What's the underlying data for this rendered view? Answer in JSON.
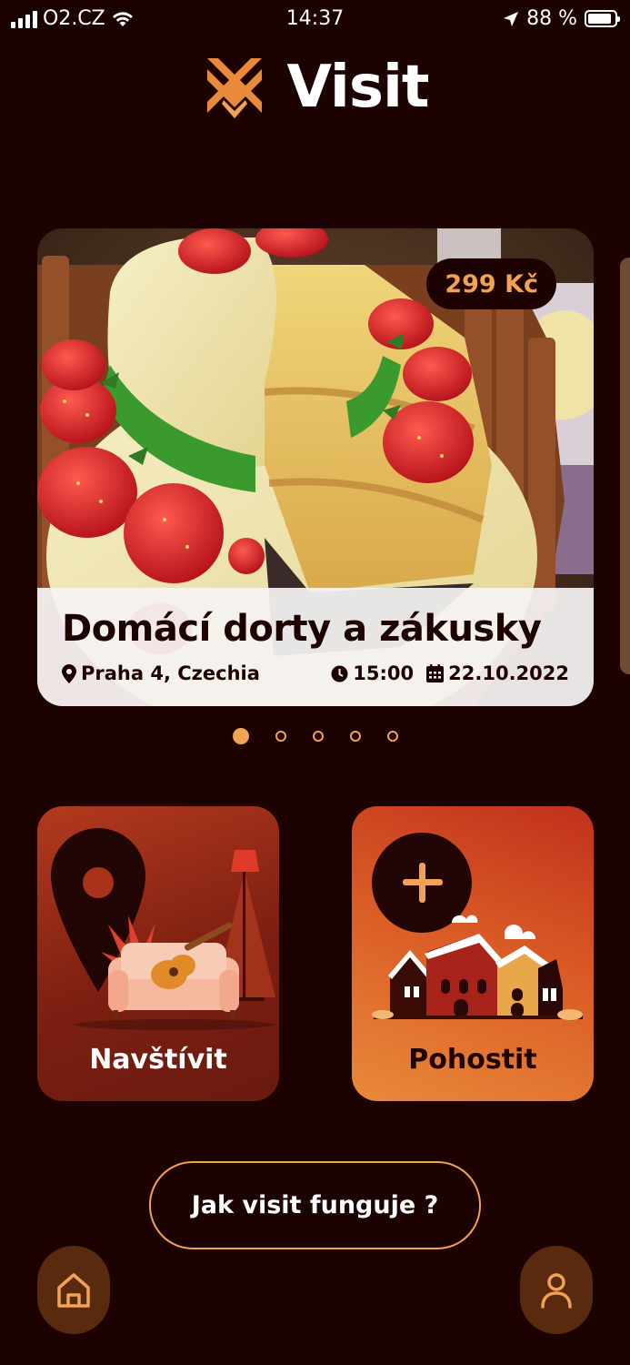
{
  "status_bar": {
    "carrier": "O2.CZ",
    "time": "14:37",
    "battery": "88 %",
    "battery_level": 0.88
  },
  "app": {
    "logo_text": "Visit",
    "accent_color": "#f2a254",
    "background_color": "#1d0202"
  },
  "carousel": {
    "active_index": 0,
    "total": 5,
    "card": {
      "price": "299 Kč",
      "title": "Domácí dorty a zákusky",
      "location": "Praha 4, Czechia",
      "time": "15:00",
      "date": "22.10.2022",
      "image_icon": "cake-photo"
    }
  },
  "tiles": {
    "visit_label": "Navštívit",
    "host_label": "Pohostit"
  },
  "how_button_label": "Jak visit funguje ?",
  "nav": {
    "home_icon": "home-icon",
    "profile_icon": "user-icon"
  }
}
